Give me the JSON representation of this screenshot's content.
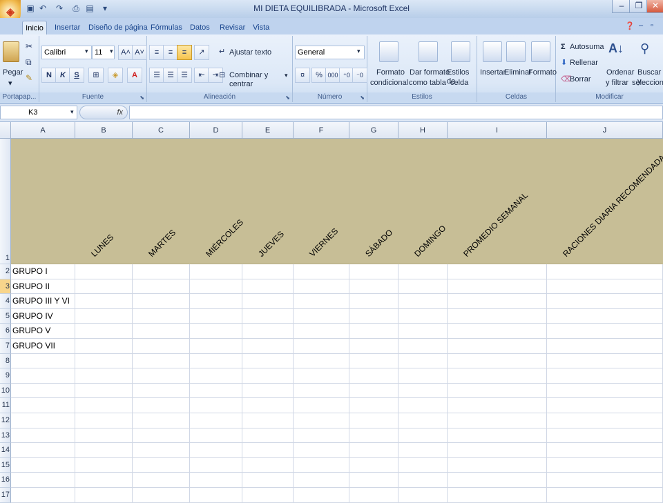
{
  "window": {
    "title": "MI DIETA EQUILIBRADA - Microsoft Excel"
  },
  "tabs": [
    "Inicio",
    "Insertar",
    "Diseño de página",
    "Fórmulas",
    "Datos",
    "Revisar",
    "Vista"
  ],
  "ribbon": {
    "portapapeles": {
      "label": "Portapap...",
      "pegar": "Pegar"
    },
    "fuente": {
      "label": "Fuente",
      "font": "Calibri",
      "size": "11",
      "bold": "N",
      "italic": "K",
      "underline": "S"
    },
    "alineacion": {
      "label": "Alineación",
      "wrap": "Ajustar texto",
      "merge": "Combinar y centrar"
    },
    "numero": {
      "label": "Número",
      "format": "General",
      "percent": "%",
      "thousands": "000"
    },
    "estilos": {
      "label": "Estilos",
      "cond1": "Formato",
      "cond2": "condicional",
      "table1": "Dar formato",
      "table2": "como tabla",
      "cell1": "Estilos de",
      "cell2": "celda"
    },
    "celdas": {
      "label": "Celdas",
      "insert": "Insertar",
      "delete": "Eliminar",
      "format": "Formato"
    },
    "modificar": {
      "label": "Modificar",
      "autosum": "Autosuma",
      "fill": "Rellenar",
      "clear": "Borrar",
      "sort1": "Ordenar",
      "sort2": "y filtrar",
      "find1": "Buscar y",
      "find2": "seleccionar"
    }
  },
  "formula_bar": {
    "name_box": "K3",
    "fx": "fx",
    "content": ""
  },
  "sheet": {
    "columns": [
      "A",
      "B",
      "C",
      "D",
      "E",
      "F",
      "G",
      "H",
      "I",
      "J"
    ],
    "row_numbers": [
      "1",
      "2",
      "3",
      "4",
      "5",
      "6",
      "7",
      "8",
      "9",
      "10",
      "11",
      "12",
      "13",
      "14",
      "15",
      "16",
      "17"
    ],
    "header_labels": [
      "LUNES",
      "MARTES",
      "MIÉRCOLES",
      "JUEVES",
      "VIERNES",
      "SÁBADO",
      "DOMINGO",
      "PROMEDIO SEMANAL",
      "RACIONES DIARIA RECOMENDADA"
    ],
    "groups": [
      "GRUPO I",
      "GRUPO II",
      "GRUPO III Y VI",
      "GRUPO IV",
      "GRUPO V",
      "GRUPO VII"
    ],
    "header_fill": "#c7be96",
    "selected_row": "3"
  }
}
